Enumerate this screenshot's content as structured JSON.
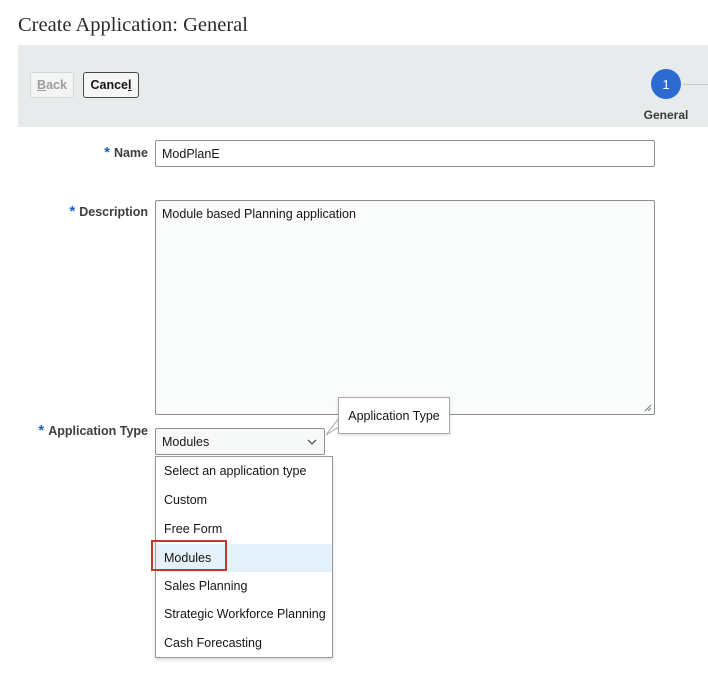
{
  "page": {
    "title": "Create Application: General"
  },
  "toolbar": {
    "back_label_underlined": "B",
    "back_label_rest": "ack",
    "cancel_label_start": "Cance",
    "cancel_label_underlined": "l"
  },
  "train": {
    "steps": [
      {
        "number": "1",
        "label": "General",
        "active": true
      }
    ],
    "accent_color": "#2b6bd1"
  },
  "form": {
    "required_marker": "*",
    "name": {
      "label": "Name",
      "value": "ModPlanE"
    },
    "description": {
      "label": "Description",
      "value": "Module based Planning application"
    },
    "application_type": {
      "label": "Application Type",
      "value": "Modules",
      "tooltip": "Application Type",
      "options": [
        "Select an application type",
        "Custom",
        "Free Form",
        "Modules",
        "Sales Planning",
        "Strategic Workforce Planning",
        "Cash Forecasting"
      ],
      "selected_index": 3
    }
  },
  "colors": {
    "required": "#1f5fbf",
    "highlight_border": "#c0392b",
    "selected_option_bg": "#e4f0fa"
  }
}
